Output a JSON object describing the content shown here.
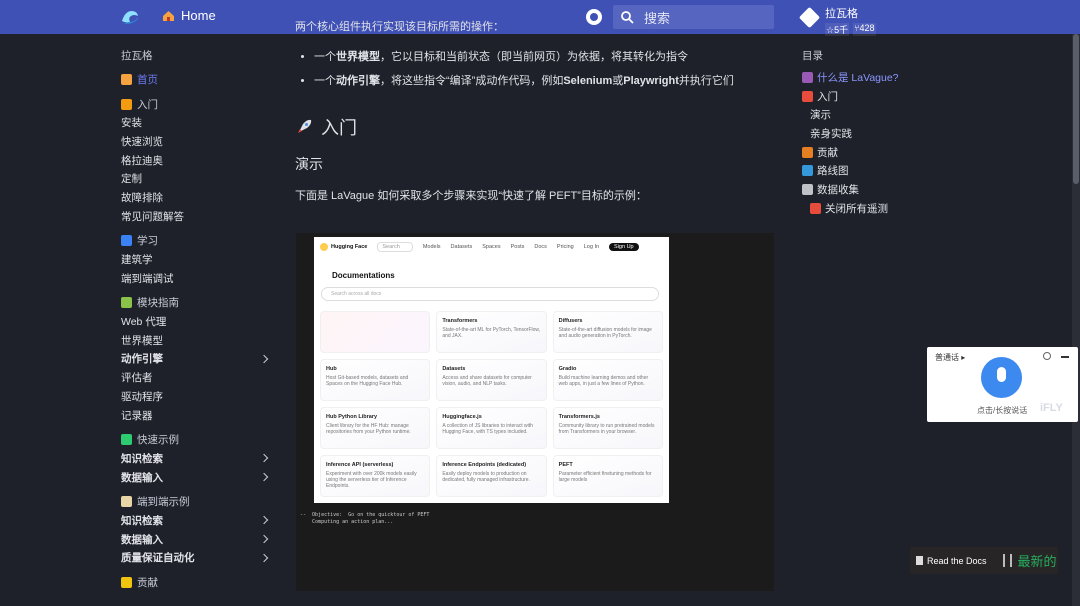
{
  "header": {
    "home_label": "Home",
    "search_placeholder": "搜索",
    "repo": {
      "name": "拉瓦格",
      "stars": "☆5千",
      "forks": "⑂428"
    }
  },
  "sidebar": {
    "title": "拉瓦格",
    "items": [
      {
        "label": "首页",
        "active": true,
        "kind": "section",
        "icon": "home-icon"
      },
      {
        "label": "入门",
        "kind": "section",
        "icon": "lightning-icon"
      },
      {
        "label": "安装"
      },
      {
        "label": "快速浏览"
      },
      {
        "label": "格拉迪奥"
      },
      {
        "label": "定制"
      },
      {
        "label": "故障排除"
      },
      {
        "label": "常见问题解答"
      },
      {
        "label": "学习",
        "kind": "section",
        "icon": "books-icon"
      },
      {
        "label": "建筑学"
      },
      {
        "label": "端到端调试"
      },
      {
        "label": "模块指南",
        "kind": "section",
        "icon": "puzzle-icon"
      },
      {
        "label": "Web 代理"
      },
      {
        "label": "世界模型"
      },
      {
        "label": "动作引擎",
        "bold": true,
        "expand": true
      },
      {
        "label": "评估者"
      },
      {
        "label": "驱动程序"
      },
      {
        "label": "记录器"
      },
      {
        "label": "快速示例",
        "kind": "section",
        "icon": "check-icon"
      },
      {
        "label": "知识检索",
        "bold": true,
        "expand": true
      },
      {
        "label": "数据输入",
        "bold": true,
        "expand": true
      },
      {
        "label": "端到端示例",
        "kind": "section",
        "icon": "page-icon"
      },
      {
        "label": "知识检索",
        "bold": true,
        "expand": true
      },
      {
        "label": "数据输入",
        "bold": true,
        "expand": true
      },
      {
        "label": "质量保证自动化",
        "bold": true,
        "expand": true
      },
      {
        "label": "贡献",
        "kind": "section",
        "icon": "hug-icon"
      }
    ]
  },
  "main": {
    "intro_line": "两个核心组件执行实现该目标所需的操作：",
    "bullet1_pre": "一个",
    "bullet1_bold": "世界模型",
    "bullet1_post": "，它以目标和当前状态（即当前网页）为依据，将其转化为指令",
    "bullet2_pre": "一个",
    "bullet2_bold": "动作引擎",
    "bullet2_mid": "，将这些指令“编译”成动作代码，例如",
    "bullet2_sel": "Selenium",
    "bullet2_or": "或",
    "bullet2_pw": "Playwright",
    "bullet2_post": "并执行它们",
    "h2": "入门",
    "h3": "演示",
    "desc": "下面是 LaVague 如何采取多个步骤来实现“快速了解 PEFT”目标的示例："
  },
  "demo": {
    "nav": [
      "Search",
      "Models",
      "Datasets",
      "Spaces",
      "Posts",
      "Docs",
      "Pricing",
      "Log In",
      "Sign Up"
    ],
    "brand": "Hugging Face",
    "title": "Documentations",
    "search": "Search across all docs",
    "cards": [
      {
        "name": "",
        "desc": ""
      },
      {
        "name": "Transformers",
        "desc": "State-of-the-art ML for PyTorch, TensorFlow, and JAX."
      },
      {
        "name": "Diffusers",
        "desc": "State-of-the-art diffusion models for image and audio generation in PyTorch."
      },
      {
        "name": "Hub",
        "desc": "Host Git-based models, datasets and Spaces on the Hugging Face Hub."
      },
      {
        "name": "Datasets",
        "desc": "Access and share datasets for computer vision, audio, and NLP tasks."
      },
      {
        "name": "Gradio",
        "desc": "Build machine learning demos and other web apps, in just a few lines of Python."
      },
      {
        "name": "Hub Python Library",
        "desc": "Client library for the HF Hub: manage repositories from your Python runtime."
      },
      {
        "name": "Huggingface.js",
        "desc": "A collection of JS libraries to interact with Hugging Face, with TS types included."
      },
      {
        "name": "Transformers.js",
        "desc": "Community library to run pretrained models from Transformers in your browser."
      },
      {
        "name": "Inference API (serverless)",
        "desc": "Experiment with over 200k models easily using the serverless tier of Inference Endpoints."
      },
      {
        "name": "Inference Endpoints (dedicated)",
        "desc": "Easily deploy models to production on dedicated, fully managed infrastructure."
      },
      {
        "name": "PEFT",
        "desc": "Parameter efficient finetuning methods for large models"
      }
    ],
    "terminal": "--  Objective:  Go on the quicktour of PEFT\n    Computing an action plan..."
  },
  "toc": {
    "title": "目录",
    "items": [
      {
        "label": "什么是 LaVague?",
        "active": true,
        "icon": "person-icon"
      },
      {
        "label": "入门",
        "icon": "rocket-icon"
      },
      {
        "label": "演示",
        "level": 2
      },
      {
        "label": "亲身实践",
        "level": 2
      },
      {
        "label": "贡献",
        "icon": "heart-icon"
      },
      {
        "label": "路线图",
        "icon": "map-icon"
      },
      {
        "label": "数据收集",
        "icon": "chart-icon"
      },
      {
        "label": "关闭所有遥测",
        "level": 2,
        "icon": "no-entry-icon"
      }
    ]
  },
  "voice": {
    "mode": "普通话 ▸",
    "hint": "点击/长按说话",
    "brand": "iFLY"
  },
  "rtd": {
    "label": "Read the Docs",
    "version": "最新的"
  }
}
